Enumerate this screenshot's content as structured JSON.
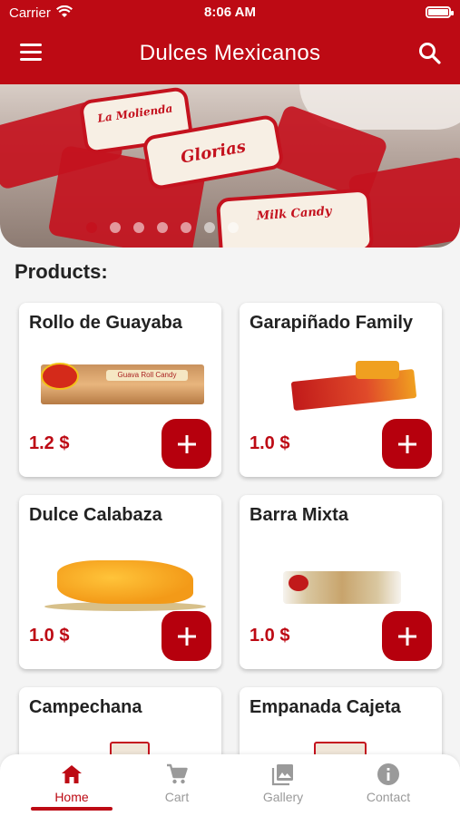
{
  "status": {
    "carrier": "Carrier",
    "time": "8:06 AM"
  },
  "header": {
    "title": "Dulces Mexicanos"
  },
  "banner": {
    "candy_label": "Glorias",
    "brand": "La Molienda",
    "subtitle": "Milk Candy",
    "slides": 7,
    "active_slide": 1
  },
  "products_heading": "Products:",
  "products": [
    {
      "name": "Rollo de Guayaba",
      "price": "1.2 $"
    },
    {
      "name": "Garapiñado Family",
      "price": "1.0 $"
    },
    {
      "name": "Dulce Calabaza",
      "price": "1.0 $"
    },
    {
      "name": "Barra Mixta",
      "price": "1.0 $"
    },
    {
      "name": "Campechana",
      "price": ""
    },
    {
      "name": "Empanada Cajeta",
      "price": ""
    }
  ],
  "nav": {
    "tabs": [
      {
        "label": "Home",
        "icon": "home-icon",
        "active": true
      },
      {
        "label": "Cart",
        "icon": "cart-icon",
        "active": false
      },
      {
        "label": "Gallery",
        "icon": "gallery-icon",
        "active": false
      },
      {
        "label": "Contact",
        "icon": "info-icon",
        "active": false
      }
    ]
  },
  "colors": {
    "primary": "#bd0a14",
    "add_button": "#b6000d",
    "inactive": "#9a9a9a"
  }
}
